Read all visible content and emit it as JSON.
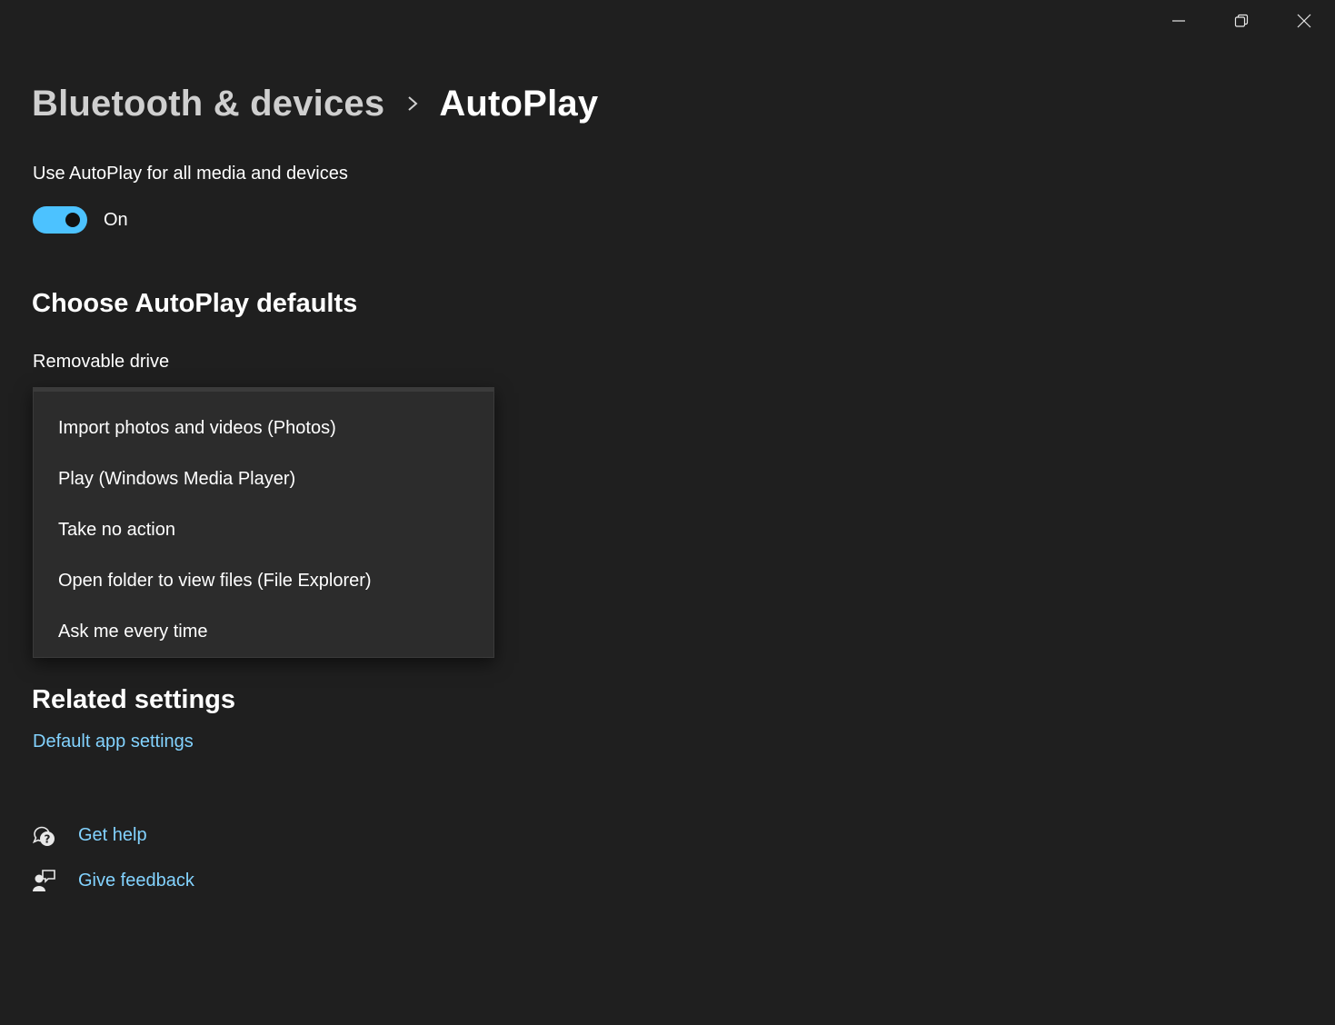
{
  "window": {
    "controls": {
      "minimize_icon": "minimize-icon",
      "restore_icon": "restore-icon",
      "close_icon": "close-icon"
    }
  },
  "breadcrumb": {
    "parent": "Bluetooth & devices",
    "separator_icon": "chevron-right-icon",
    "current": "AutoPlay"
  },
  "autoplay_setting": {
    "label": "Use AutoPlay for all media and devices",
    "toggle_state": "On",
    "toggle_on": true,
    "accent_color": "#4cc2ff"
  },
  "choose_defaults": {
    "title": "Choose AutoPlay defaults",
    "removable_drive": {
      "label": "Removable drive",
      "options": [
        "Import photos and videos (Photos)",
        "Play (Windows Media Player)",
        "Take no action",
        "Open folder to view files (File Explorer)",
        "Ask me every time"
      ]
    }
  },
  "related_settings": {
    "title": "Related settings",
    "default_app_link": "Default app settings"
  },
  "footer": {
    "get_help": "Get help",
    "get_help_icon": "help-chat-icon",
    "give_feedback": "Give feedback",
    "give_feedback_icon": "feedback-person-icon",
    "link_color": "#83d3ff"
  }
}
